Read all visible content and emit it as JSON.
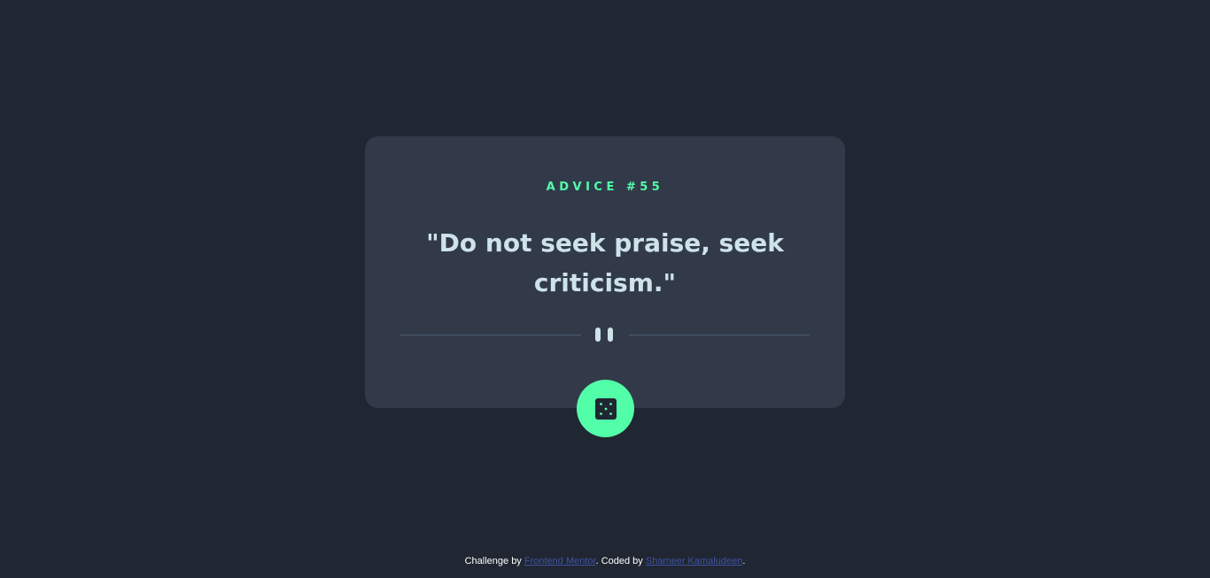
{
  "advice": {
    "id_label": "ADVICE #55",
    "quote": "\"Do not seek praise, seek criticism.\""
  },
  "dice_button": {
    "icon": "dice-icon"
  },
  "attribution": {
    "challenge_prefix": "Challenge by",
    "challenge_link": "Frontend Mentor",
    "coded_prefix": ". Coded by",
    "coded_link": "Shameer Kamaludeen",
    "suffix": "."
  },
  "colors": {
    "background": "#202632",
    "card": "#323a4a",
    "accent": "#52ffa8",
    "text": "#cee3e9",
    "divider": "#4f5d74",
    "link": "#3e52a3"
  }
}
